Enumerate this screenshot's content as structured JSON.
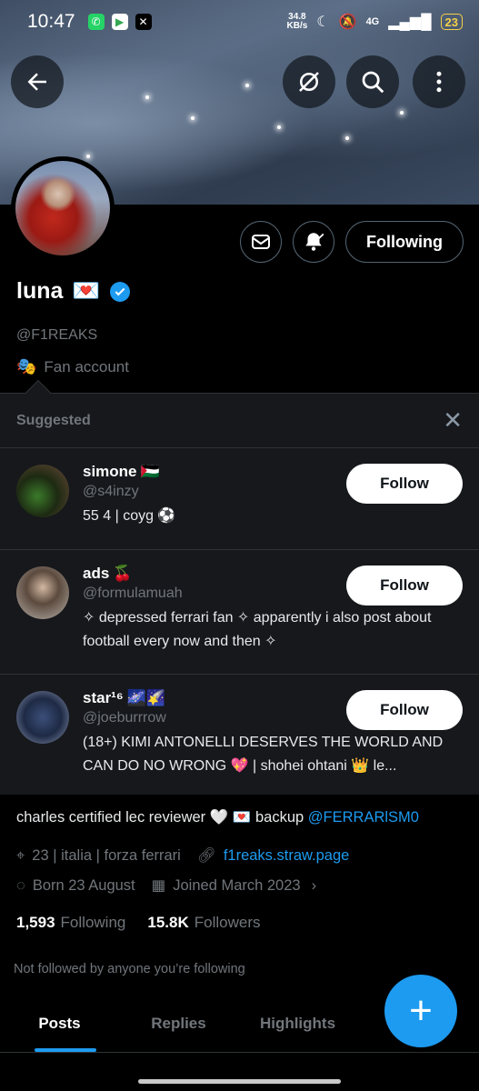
{
  "status_bar": {
    "time": "10:47",
    "net_speed": "34.8",
    "net_unit": "KB/s",
    "network": "4G",
    "battery": "23"
  },
  "profile": {
    "name": "luna",
    "name_emoji": "💌",
    "handle": "@F1REAKS",
    "affiliation": "Fan account",
    "following_label": "Following"
  },
  "suggested": {
    "title": "Suggested",
    "items": [
      {
        "name": "simone",
        "flag": "🇵🇸",
        "handle": "@s4inzy",
        "bio": "55 4 | coyg ⚽",
        "follow_label": "Follow"
      },
      {
        "name": "ads",
        "flag": "🍒",
        "handle": "@formulamuah",
        "bio": "✧ depressed ferrari fan ✧ apparently i also post about football every now and then ✧",
        "follow_label": "Follow"
      },
      {
        "name": "star¹⁶",
        "flag": "🌌🌠",
        "handle": "@joeburrrow",
        "bio": "(18+) KIMI ANTONELLI DESERVES THE WORLD AND CAN DO NO WRONG 💖 | shohei ohtani 👑 le...",
        "follow_label": "Follow"
      }
    ]
  },
  "bio": {
    "text": "charles certified lec reviewer 🤍 💌 backup ",
    "mention": "@FERRARlSM0"
  },
  "meta": {
    "location": "23 | italia | forza ferrari",
    "website": "f1reaks.straw.page",
    "birthday": "Born 23 August",
    "joined": "Joined March 2023"
  },
  "stats": {
    "following_count": "1,593",
    "following_label": "Following",
    "followers_count": "15.8K",
    "followers_label": "Followers"
  },
  "not_followed": "Not followed by anyone you’re following",
  "tabs": [
    "Posts",
    "Replies",
    "Highlights"
  ],
  "fab_label": "+"
}
